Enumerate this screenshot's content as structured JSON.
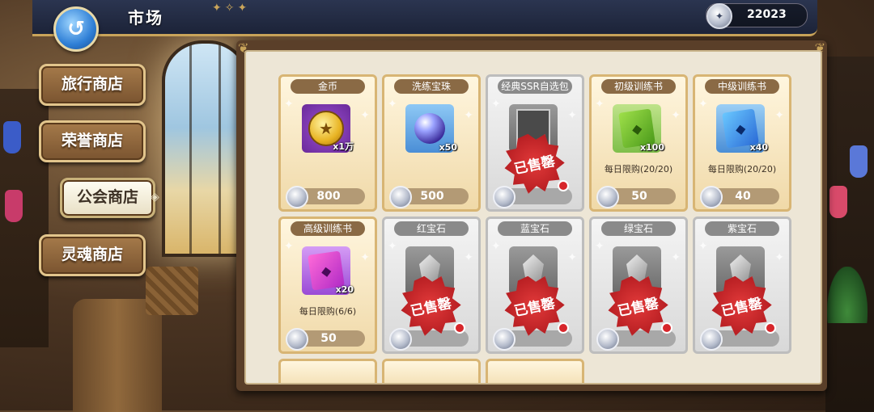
{
  "header": {
    "title": "市场",
    "back_icon": "back-arrow-icon",
    "currency_icon": "silver-medal-icon",
    "currency_value": "22023"
  },
  "tabs": [
    {
      "label": "旅行商店",
      "active": false
    },
    {
      "label": "荣誉商店",
      "active": false
    },
    {
      "label": "公会商店",
      "active": true
    },
    {
      "label": "灵魂商店",
      "active": false
    }
  ],
  "items": [
    {
      "title": "金币",
      "qty": "x1万",
      "limit": "",
      "price": "800",
      "style": "gold",
      "sold_out": false,
      "icon": "gold-coin-icon"
    },
    {
      "title": "洗练宝珠",
      "qty": "x50",
      "limit": "",
      "price": "500",
      "style": "gold",
      "sold_out": false,
      "icon": "purple-orb-icon"
    },
    {
      "title": "经典SSR自选包",
      "qty": "",
      "limit": "",
      "price": "",
      "style": "gray",
      "sold_out": true,
      "icon": "ssr-pack-icon"
    },
    {
      "title": "初级训练书",
      "qty": "x100",
      "limit": "每日限购(20/20)",
      "price": "50",
      "style": "gold",
      "sold_out": false,
      "icon": "green-book-icon"
    },
    {
      "title": "中级训练书",
      "qty": "x40",
      "limit": "每日限购(20/20)",
      "price": "40",
      "style": "gold",
      "sold_out": false,
      "icon": "blue-book-icon"
    },
    {
      "title": "高级训练书",
      "qty": "x20",
      "limit": "每日限购(6/6)",
      "price": "50",
      "style": "gold",
      "sold_out": false,
      "icon": "purple-book-icon"
    },
    {
      "title": "红宝石",
      "qty": "",
      "limit": "",
      "price": "",
      "style": "gray",
      "sold_out": true,
      "icon": "gem-icon"
    },
    {
      "title": "蓝宝石",
      "qty": "",
      "limit": "",
      "price": "",
      "style": "gray",
      "sold_out": true,
      "icon": "gem-icon"
    },
    {
      "title": "绿宝石",
      "qty": "",
      "limit": "",
      "price": "",
      "style": "gray",
      "sold_out": true,
      "icon": "gem-icon"
    },
    {
      "title": "紫宝石",
      "qty": "",
      "limit": "",
      "price": "",
      "style": "gray",
      "sold_out": true,
      "icon": "gem-icon"
    }
  ],
  "sold_out_label": "已售罄",
  "colors": {
    "gold_card": "#f0d9a8",
    "sold_stamp": "#c8232a",
    "accent": "#c9a45a"
  }
}
